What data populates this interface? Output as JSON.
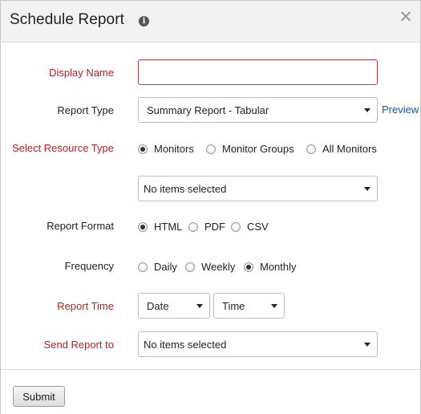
{
  "dialog": {
    "title": "Schedule Report",
    "info_icon_glyph": "i",
    "close_glyph": "✕"
  },
  "form": {
    "display_name": {
      "label": "Display Name",
      "value": "",
      "placeholder": ""
    },
    "report_type": {
      "label": "Report Type",
      "selected": "Summary Report - Tabular",
      "preview_link": "Preview"
    },
    "resource_type": {
      "label": "Select Resource Type",
      "options": [
        "Monitors",
        "Monitor Groups",
        "All Monitors"
      ],
      "selected_index": 0
    },
    "resource_select": {
      "selected": "No items selected"
    },
    "report_format": {
      "label": "Report Format",
      "options": [
        "HTML",
        "PDF",
        "CSV"
      ],
      "selected_index": 0
    },
    "frequency": {
      "label": "Frequency",
      "options": [
        "Daily",
        "Weekly",
        "Monthly"
      ],
      "selected_index": 2
    },
    "report_time": {
      "label": "Report Time",
      "date": "Date",
      "time": "Time"
    },
    "send_report_to": {
      "label": "Send Report to",
      "selected": "No items selected"
    }
  },
  "footer": {
    "submit_label": "Submit"
  },
  "colors": {
    "required_label": "#b22222",
    "link": "#1a56a8",
    "error_border": "#c23a3a"
  }
}
